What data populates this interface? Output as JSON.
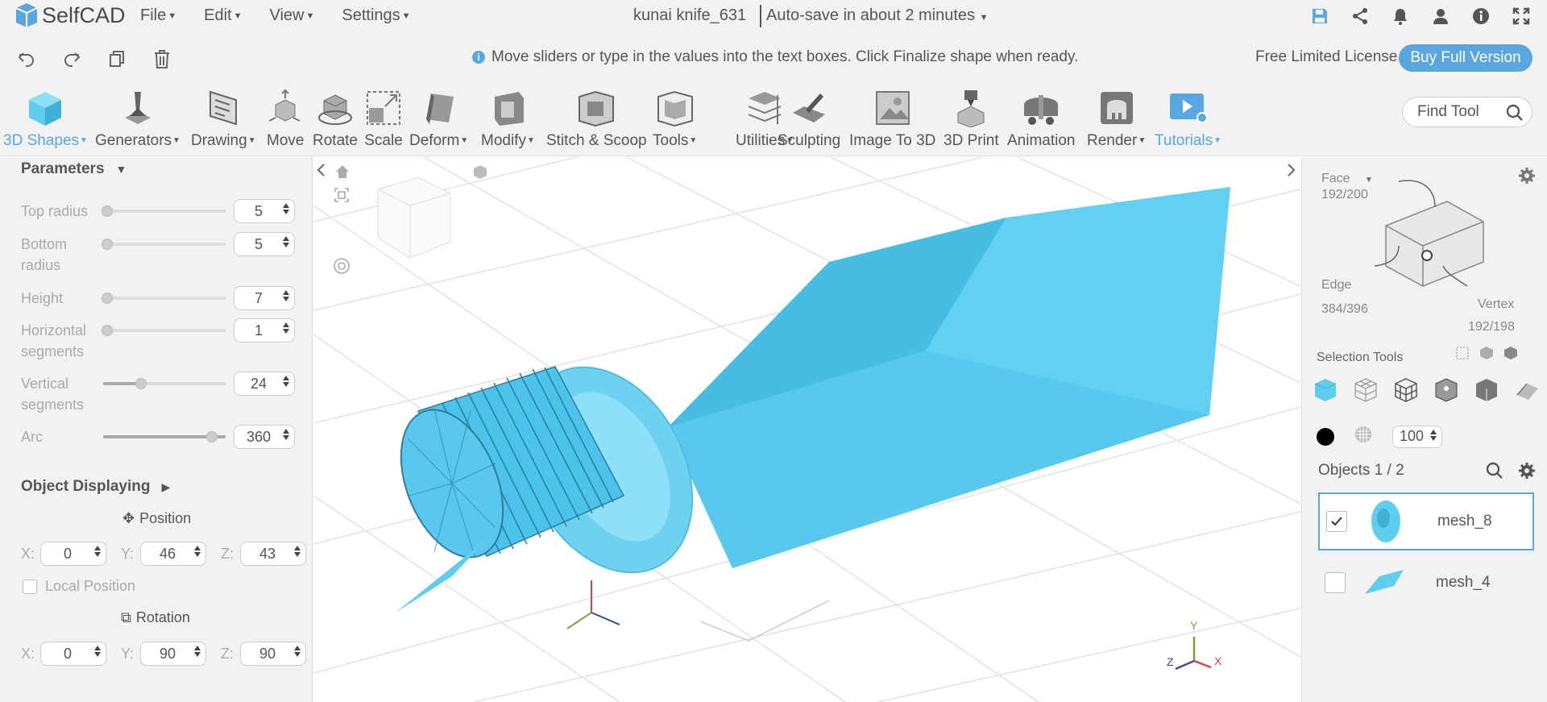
{
  "app": {
    "logo_text": "SelfCAD",
    "file_title": "kunai knife_631",
    "autosave": "Auto-save in about 2 minutes"
  },
  "menu": [
    {
      "label": "File"
    },
    {
      "label": "Edit"
    },
    {
      "label": "View"
    },
    {
      "label": "Settings"
    }
  ],
  "top_icons": [
    "save-icon",
    "share-icon",
    "bell-icon",
    "user-icon",
    "info-icon",
    "fullscreen-icon"
  ],
  "actionbar": {
    "hint": "Move sliders or type in the values into the text boxes. Click Finalize shape when ready.",
    "license": "Free Limited License",
    "buy_button": "Buy Full Version"
  },
  "toolbar": {
    "tools": [
      {
        "label": "3D Shapes",
        "icon": "cube-icon",
        "dropdown": true,
        "active": true
      },
      {
        "label": "Generators",
        "icon": "generator-icon",
        "dropdown": true
      },
      {
        "label": "Drawing",
        "icon": "drawing-icon",
        "dropdown": true
      },
      {
        "label": "Move",
        "icon": "move-icon",
        "dropdown": false
      },
      {
        "label": "Rotate",
        "icon": "rotate-icon",
        "dropdown": false
      },
      {
        "label": "Scale",
        "icon": "scale-icon",
        "dropdown": false
      },
      {
        "label": "Deform",
        "icon": "deform-icon",
        "dropdown": true
      },
      {
        "label": "Modify",
        "icon": "modify-icon",
        "dropdown": true
      },
      {
        "label": "Stitch & Scoop",
        "icon": "stitch-scoop-icon",
        "dropdown": false
      },
      {
        "label": "Tools",
        "icon": "tools-icon",
        "dropdown": true
      },
      {
        "label": "Utilities",
        "icon": "utilities-icon",
        "dropdown": true
      },
      {
        "label": "Sculpting",
        "icon": "sculpting-icon",
        "dropdown": false
      },
      {
        "label": "Image To 3D",
        "icon": "image-to-3d-icon",
        "dropdown": false
      },
      {
        "label": "3D Print",
        "icon": "3d-print-icon",
        "dropdown": false
      },
      {
        "label": "Animation",
        "icon": "animation-icon",
        "dropdown": false
      },
      {
        "label": "Render",
        "icon": "render-icon",
        "dropdown": true
      },
      {
        "label": "Tutorials",
        "icon": "tutorials-icon",
        "dropdown": true,
        "blue": true
      }
    ],
    "find_placeholder": "Find Tool"
  },
  "parameters": {
    "title": "Parameters",
    "rows": [
      {
        "label": "Top radius",
        "value": "5",
        "level": 0.0
      },
      {
        "label": "Bottom radius",
        "value": "5",
        "level": 0.0
      },
      {
        "label": "Height",
        "value": "7",
        "level": 0.0
      },
      {
        "label": "Horizontal segments",
        "value": "1",
        "level": 0.0
      },
      {
        "label": "Vertical segments",
        "value": "24",
        "level": 0.3
      },
      {
        "label": "Arc",
        "value": "360",
        "level": 1.0
      }
    ]
  },
  "object_displaying": {
    "title": "Object Displaying",
    "position_label": "Position",
    "position": {
      "x": "0",
      "y": "46",
      "z": "43"
    },
    "local_position_label": "Local Position",
    "rotation_label": "Rotation",
    "rotation": {
      "x": "0",
      "y": "90",
      "z": "90"
    },
    "axis_labels": {
      "x": "X:",
      "y": "Y:",
      "z": "Z:"
    }
  },
  "viewcube": {
    "face_label": "Face",
    "face_count": "192/200",
    "edge_label": "Edge",
    "edge_count": "384/396",
    "vertex_label": "Vertex",
    "vertex_count": "192/198"
  },
  "selection": {
    "title": "Selection Tools",
    "opacity": "100"
  },
  "objects": {
    "title": "Objects 1 / 2",
    "items": [
      {
        "name": "mesh_8",
        "checked": true,
        "selected": true
      },
      {
        "name": "mesh_4",
        "checked": false,
        "selected": false
      }
    ]
  },
  "axes": {
    "x": "X",
    "y": "Y",
    "z": "Z"
  },
  "colors": {
    "accent": "#5aa6e0",
    "mesh": "#5fcdee",
    "mesh_dark": "#3fb0d6"
  }
}
